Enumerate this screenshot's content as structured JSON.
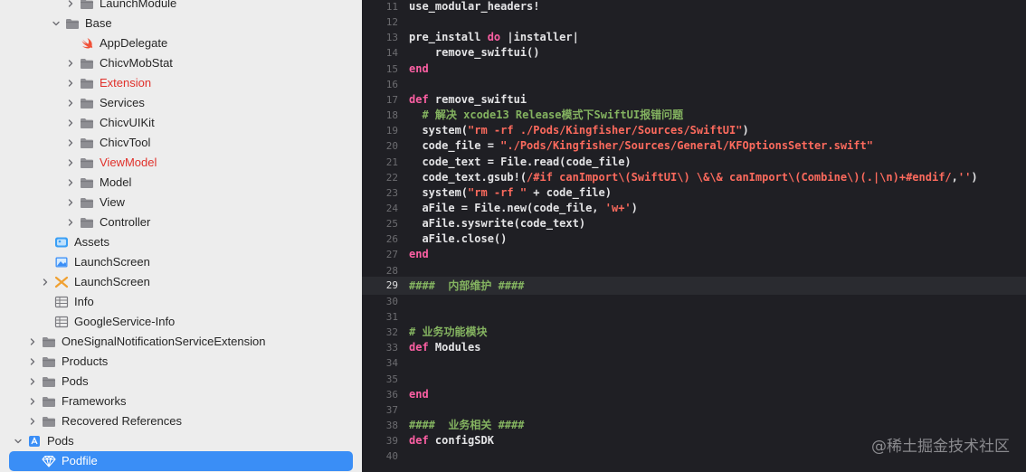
{
  "navigator": {
    "items": [
      {
        "label": "LaunchModule",
        "indent": 72,
        "chevron": "right",
        "icon": "folder-icon"
      },
      {
        "label": "Base",
        "indent": 56,
        "chevron": "down",
        "icon": "folder-icon"
      },
      {
        "label": "AppDelegate",
        "indent": 72,
        "chevron": "none",
        "icon": "swift-file-icon"
      },
      {
        "label": "ChicvMobStat",
        "indent": 72,
        "chevron": "right",
        "icon": "folder-icon"
      },
      {
        "label": "Extension",
        "indent": 72,
        "chevron": "right",
        "icon": "folder-icon",
        "red": true
      },
      {
        "label": "Services",
        "indent": 72,
        "chevron": "right",
        "icon": "folder-icon"
      },
      {
        "label": "ChicvUIKit",
        "indent": 72,
        "chevron": "right",
        "icon": "folder-icon"
      },
      {
        "label": "ChicvTool",
        "indent": 72,
        "chevron": "right",
        "icon": "folder-icon"
      },
      {
        "label": "ViewModel",
        "indent": 72,
        "chevron": "right",
        "icon": "folder-icon",
        "red": true
      },
      {
        "label": "Model",
        "indent": 72,
        "chevron": "right",
        "icon": "folder-icon"
      },
      {
        "label": "View",
        "indent": 72,
        "chevron": "right",
        "icon": "folder-icon"
      },
      {
        "label": "Controller",
        "indent": 72,
        "chevron": "right",
        "icon": "folder-icon"
      },
      {
        "label": "Assets",
        "indent": 44,
        "chevron": "none",
        "icon": "assets-icon"
      },
      {
        "label": "LaunchScreen",
        "indent": 44,
        "chevron": "none",
        "icon": "image-icon"
      },
      {
        "label": "LaunchScreen",
        "indent": 44,
        "chevron": "right",
        "icon": "storyboard-icon"
      },
      {
        "label": "Info",
        "indent": 44,
        "chevron": "none",
        "icon": "plist-icon"
      },
      {
        "label": "GoogleService-Info",
        "indent": 44,
        "chevron": "none",
        "icon": "plist-icon"
      },
      {
        "label": "OneSignalNotificationServiceExtension",
        "indent": 30,
        "chevron": "right",
        "icon": "folder-icon"
      },
      {
        "label": "Products",
        "indent": 30,
        "chevron": "right",
        "icon": "folder-icon"
      },
      {
        "label": "Pods",
        "indent": 30,
        "chevron": "right",
        "icon": "folder-icon"
      },
      {
        "label": "Frameworks",
        "indent": 30,
        "chevron": "right",
        "icon": "folder-icon"
      },
      {
        "label": "Recovered References",
        "indent": 30,
        "chevron": "right",
        "icon": "folder-icon"
      },
      {
        "label": "Pods",
        "indent": 14,
        "chevron": "down",
        "icon": "project-icon"
      },
      {
        "label": "Podfile",
        "indent": 30,
        "chevron": "none",
        "icon": "ruby-gem-icon",
        "selected": true
      }
    ]
  },
  "editor": {
    "current_line": "29",
    "lines": [
      {
        "n": "11",
        "tokens": [
          {
            "t": "use_modular_headers!",
            "c": "plain"
          }
        ]
      },
      {
        "n": "12",
        "tokens": []
      },
      {
        "n": "13",
        "tokens": [
          {
            "t": "pre_install ",
            "c": "plain"
          },
          {
            "t": "do",
            "c": "kw"
          },
          {
            "t": " |installer|",
            "c": "plain"
          }
        ]
      },
      {
        "n": "14",
        "tokens": [
          {
            "t": "    remove_swiftui()",
            "c": "plain"
          }
        ]
      },
      {
        "n": "15",
        "tokens": [
          {
            "t": "end",
            "c": "kw"
          }
        ]
      },
      {
        "n": "16",
        "tokens": []
      },
      {
        "n": "17",
        "tokens": [
          {
            "t": "def",
            "c": "kw"
          },
          {
            "t": " remove_swiftui",
            "c": "plain"
          }
        ]
      },
      {
        "n": "18",
        "tokens": [
          {
            "t": "  # 解决 xcode13 Release模式下SwiftUI报错问题",
            "c": "cmt"
          }
        ]
      },
      {
        "n": "19",
        "tokens": [
          {
            "t": "  system(",
            "c": "plain"
          },
          {
            "t": "\"rm -rf ./Pods/Kingfisher/Sources/SwiftUI\"",
            "c": "str"
          },
          {
            "t": ")",
            "c": "plain"
          }
        ]
      },
      {
        "n": "20",
        "tokens": [
          {
            "t": "  code_file = ",
            "c": "plain"
          },
          {
            "t": "\"./Pods/Kingfisher/Sources/General/KFOptionsSetter.swift\"",
            "c": "str"
          }
        ]
      },
      {
        "n": "21",
        "tokens": [
          {
            "t": "  code_text = File.read(code_file)",
            "c": "plain"
          }
        ]
      },
      {
        "n": "22",
        "tokens": [
          {
            "t": "  code_text.gsub!(",
            "c": "plain"
          },
          {
            "t": "/#if canImport\\(SwiftUI\\) \\&\\& canImport\\(Combine\\)(.|\\n)+#endif/",
            "c": "str"
          },
          {
            "t": ",",
            "c": "plain"
          },
          {
            "t": "''",
            "c": "str"
          },
          {
            "t": ")",
            "c": "plain"
          }
        ]
      },
      {
        "n": "23",
        "tokens": [
          {
            "t": "  system(",
            "c": "plain"
          },
          {
            "t": "\"rm -rf \"",
            "c": "str"
          },
          {
            "t": " + code_file)",
            "c": "plain"
          }
        ]
      },
      {
        "n": "24",
        "tokens": [
          {
            "t": "  aFile = File.new(code_file, ",
            "c": "plain"
          },
          {
            "t": "'w+'",
            "c": "str"
          },
          {
            "t": ")",
            "c": "plain"
          }
        ]
      },
      {
        "n": "25",
        "tokens": [
          {
            "t": "  aFile.syswrite(code_text)",
            "c": "plain"
          }
        ]
      },
      {
        "n": "26",
        "tokens": [
          {
            "t": "  aFile.close()",
            "c": "plain"
          }
        ]
      },
      {
        "n": "27",
        "tokens": [
          {
            "t": "end",
            "c": "kw"
          }
        ]
      },
      {
        "n": "28",
        "tokens": []
      },
      {
        "n": "29",
        "tokens": [
          {
            "t": "####  内部维护 ####",
            "c": "cmt"
          }
        ]
      },
      {
        "n": "30",
        "tokens": []
      },
      {
        "n": "31",
        "tokens": []
      },
      {
        "n": "32",
        "tokens": [
          {
            "t": "# 业务功能模块",
            "c": "cmt"
          }
        ]
      },
      {
        "n": "33",
        "tokens": [
          {
            "t": "def",
            "c": "kw"
          },
          {
            "t": " Modules",
            "c": "plain"
          }
        ]
      },
      {
        "n": "34",
        "tokens": []
      },
      {
        "n": "35",
        "tokens": []
      },
      {
        "n": "36",
        "tokens": [
          {
            "t": "end",
            "c": "kw"
          }
        ]
      },
      {
        "n": "37",
        "tokens": []
      },
      {
        "n": "38",
        "tokens": [
          {
            "t": "####  业务相关 ####",
            "c": "cmt"
          }
        ]
      },
      {
        "n": "39",
        "tokens": [
          {
            "t": "def",
            "c": "kw"
          },
          {
            "t": " configSDK",
            "c": "plain"
          }
        ]
      },
      {
        "n": "40",
        "tokens": []
      }
    ]
  },
  "watermark": "@稀土掘金技术社区",
  "colors": {
    "keyword": "#fc5fa3",
    "string": "#fc6a5d",
    "comment": "#84b360",
    "selection": "#3a8ef6",
    "folder": "#8a8a8e",
    "red_folder_label": "#e0312b"
  }
}
